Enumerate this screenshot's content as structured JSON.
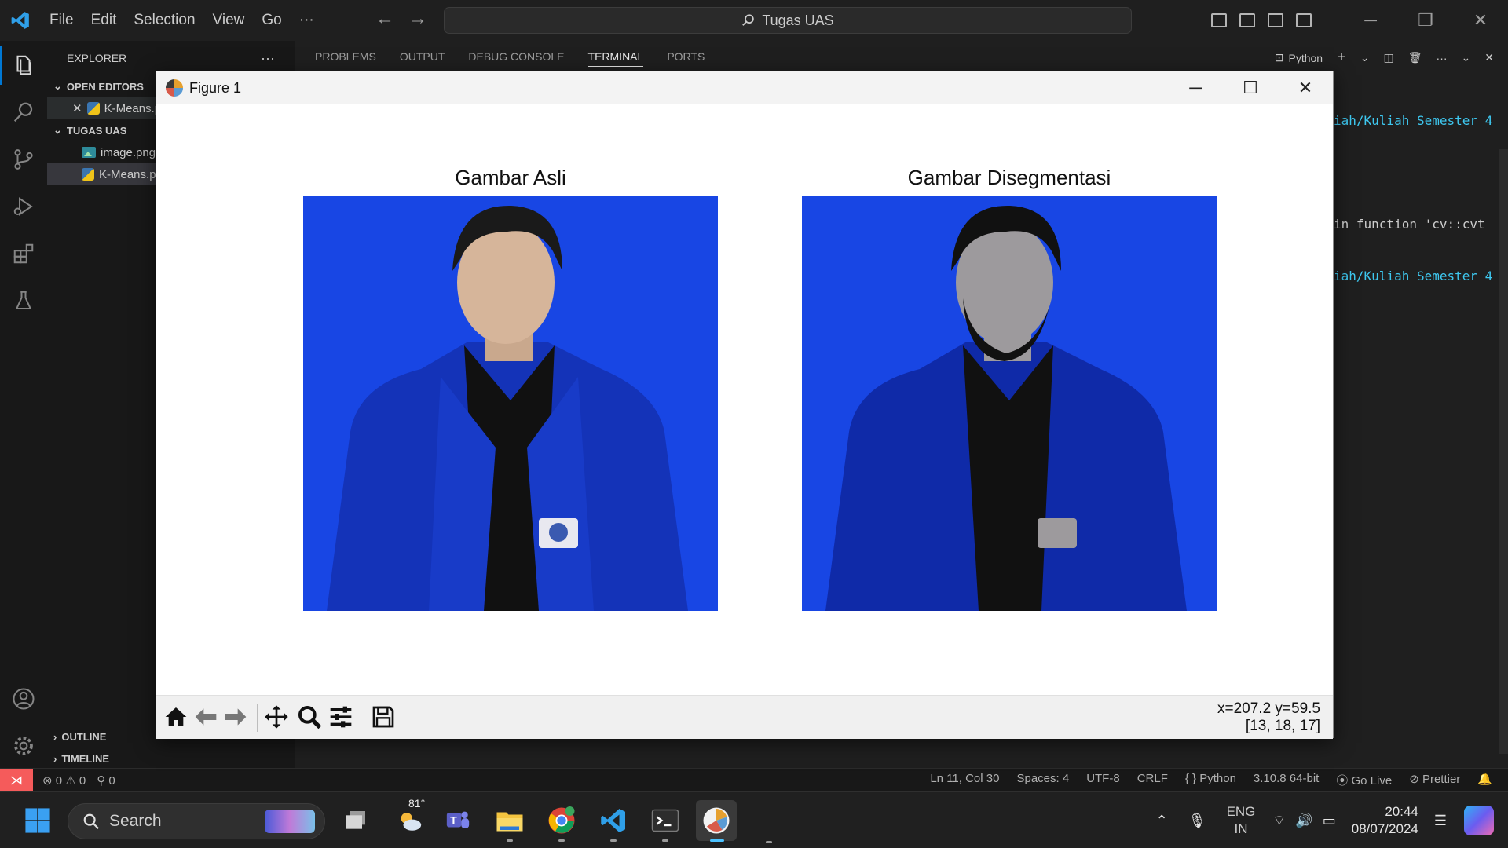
{
  "titlebar": {
    "menu": [
      "File",
      "Edit",
      "Selection",
      "View",
      "Go",
      "···"
    ],
    "search_text": "Tugas UAS"
  },
  "sidebar": {
    "header": "EXPLORER",
    "more": "···",
    "open_editors_label": "OPEN EDITORS",
    "open_editors": [
      {
        "name": "K-Means.py",
        "icon": "python-file-icon"
      }
    ],
    "folder_label": "TUGAS UAS",
    "files": [
      {
        "name": "image.png",
        "icon": "image-file-icon"
      },
      {
        "name": "K-Means.py",
        "icon": "python-file-icon",
        "selected": true
      }
    ],
    "outline_label": "OUTLINE",
    "timeline_label": "TIMELINE"
  },
  "panel": {
    "tabs": [
      "PROBLEMS",
      "OUTPUT",
      "DEBUG CONSOLE",
      "TERMINAL",
      "PORTS"
    ],
    "active_tab": "TERMINAL",
    "terminal_profile": "Python",
    "terminal_lines": [
      "iah/Kuliah Semester 4",
      " in function 'cv::cvt",
      "iah/Kuliah Semester 4"
    ]
  },
  "figure": {
    "window_title": "Figure 1",
    "left_title": "Gambar Asli",
    "right_title": "Gambar Disegmentasi",
    "coord_line1": "x=207.2 y=59.5",
    "coord_line2": "[13, 18, 17]",
    "toolbar_tools": [
      "home-icon",
      "back-arrow-icon",
      "forward-arrow-icon",
      "pan-icon",
      "zoom-icon",
      "configure-subplots-icon",
      "save-icon"
    ]
  },
  "statusbar": {
    "errors": "0",
    "warnings": "0",
    "ports": "0",
    "position": "Ln 11, Col 30",
    "spaces": "Spaces: 4",
    "encoding": "UTF-8",
    "eol": "CRLF",
    "language": "Python",
    "interpreter": "3.10.8 64-bit",
    "golive": "Go Live",
    "prettier": "Prettier"
  },
  "taskbar": {
    "search_placeholder": "Search",
    "weather": "81°",
    "lang_top": "ENG",
    "lang_bottom": "IN",
    "time": "20:44",
    "date": "08/07/2024"
  },
  "colors": {
    "accent": "#0078d4",
    "photo_background": "#1846e4",
    "remote_indicator": "#f55b5b",
    "terminal_path": "#3ec8f0"
  }
}
